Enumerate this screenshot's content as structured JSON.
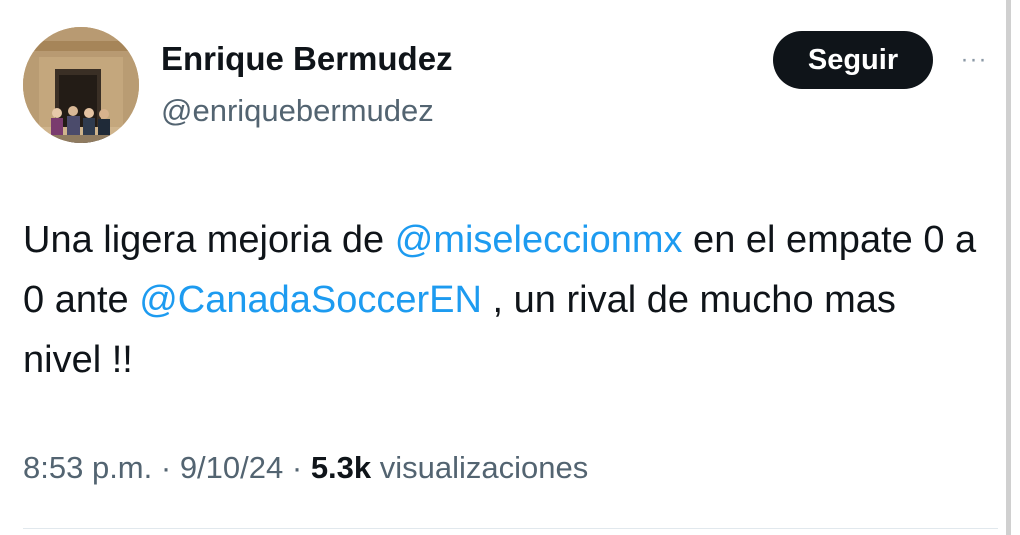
{
  "author": {
    "display_name": "Enrique Bermudez",
    "handle": "@enriquebermudez",
    "avatar_icon": "profile-photo"
  },
  "actions": {
    "follow_label": "Seguir",
    "more_label": "···"
  },
  "tweet": {
    "text_1": "Una ligera mejoria de ",
    "mention_1": "@miseleccionmx",
    "text_2": "  en el empate 0 a 0 ante ",
    "mention_2": "@CanadaSoccerEN",
    "text_3": " , un rival de mucho mas nivel !!"
  },
  "meta": {
    "time": "8:53 p.m.",
    "sep1": " · ",
    "date": "9/10/24",
    "sep2": " · ",
    "views_count": "5.3k",
    "views_label": " visualizaciones"
  },
  "colors": {
    "mention": "#1d9bf0",
    "follow_bg": "#0f1419",
    "secondary_text": "#536471"
  }
}
